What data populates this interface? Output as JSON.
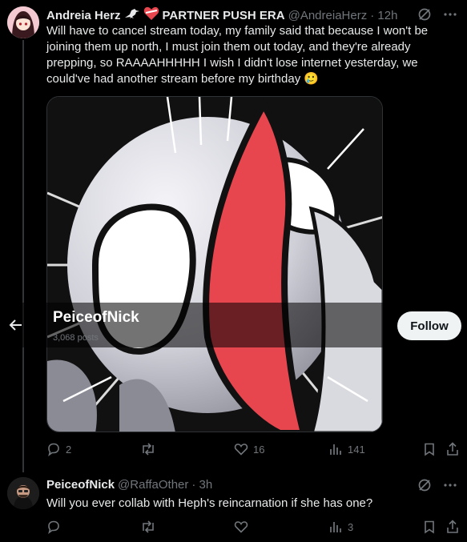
{
  "tweet1": {
    "name": "Andreia Herz",
    "badge": "PARTNER PUSH ERA",
    "handle": "@AndreiaHerz",
    "time": "· 12h",
    "text": "Will have to cancel stream today, my family said that because I won't be joining them up north, I must join them out today, and they're already prepping, so RAAAAHHHHH I wish I didn't lose internet yesterday, we could've had another stream before my birthday 🥲",
    "replies": "2",
    "reposts": "",
    "likes": "16",
    "views": "141"
  },
  "profile_overlay": {
    "name": "PeiceofNick",
    "posts": "3,068 posts",
    "follow_label": "Follow"
  },
  "tweet2": {
    "name": "PeiceofNick",
    "handle": "@RaffaOther",
    "time": "· 3h",
    "text": "Will you ever collab with Heph's reincarnation if she has one?",
    "replies": "",
    "reposts": "",
    "likes": "",
    "views": "3"
  },
  "colors": {
    "background": "#000000",
    "muted": "#71767b",
    "accent_red": "#e8464f"
  },
  "icons": [
    "reply-icon",
    "repost-icon",
    "like-icon",
    "views-icon",
    "bookmark-icon",
    "share-icon",
    "grok-icon",
    "more-icon",
    "back-arrow-icon",
    "crow-icon",
    "heart-emoji-icon"
  ]
}
